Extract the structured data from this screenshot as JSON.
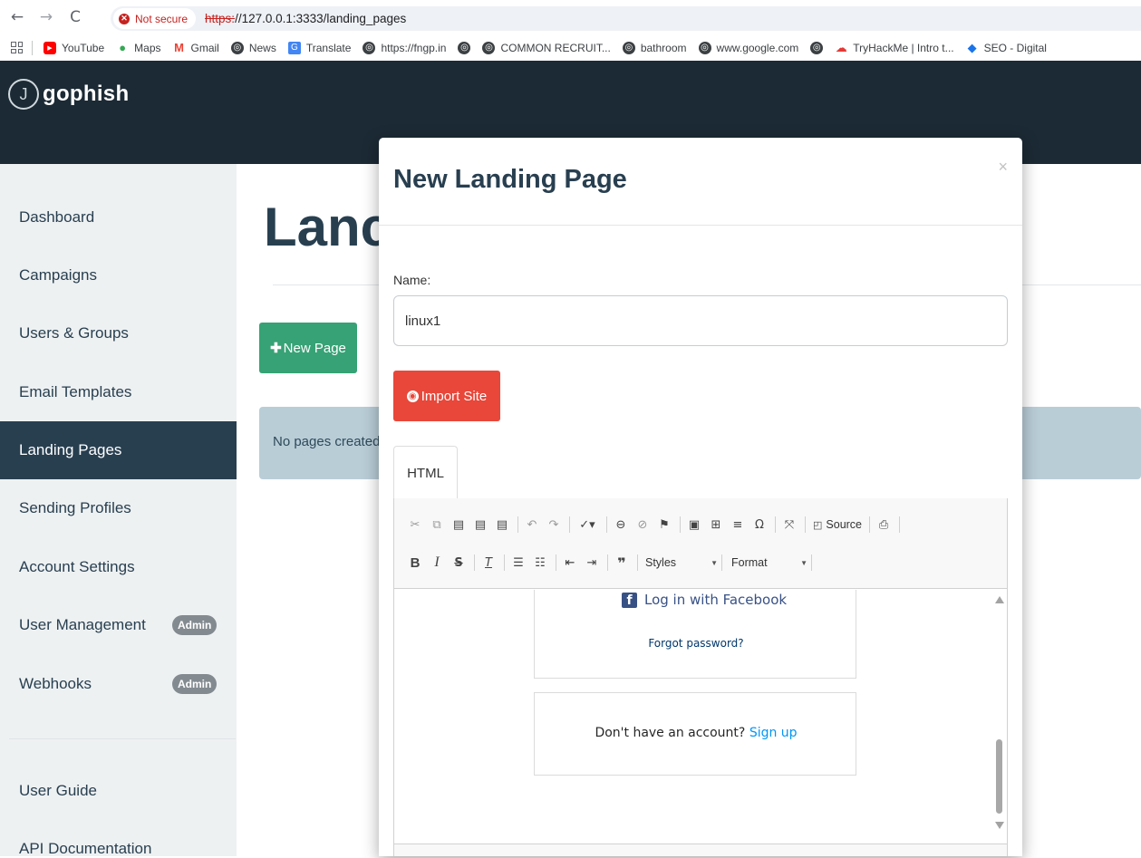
{
  "browser": {
    "security_label": "Not secure",
    "url_scheme": "https:",
    "url_rest": "//127.0.0.1:3333/landing_pages",
    "bookmarks": [
      "YouTube",
      "Maps",
      "Gmail",
      "News",
      "Translate",
      "https://fngp.in",
      "",
      "COMMON RECRUIT...",
      "bathroom",
      "www.google.com",
      "",
      "TryHackMe | Intro t...",
      "SEO - Digital"
    ]
  },
  "app": {
    "logo_text": "gophish"
  },
  "sidebar": {
    "items": [
      {
        "label": "Dashboard"
      },
      {
        "label": "Campaigns"
      },
      {
        "label": "Users & Groups"
      },
      {
        "label": "Email Templates"
      },
      {
        "label": "Landing Pages"
      },
      {
        "label": "Sending Profiles"
      },
      {
        "label": "Account Settings"
      },
      {
        "label": "User Management",
        "badge": "Admin"
      },
      {
        "label": "Webhooks",
        "badge": "Admin"
      },
      {
        "label": "User Guide"
      },
      {
        "label": "API Documentation"
      }
    ]
  },
  "main": {
    "title": "Landing Pages",
    "title_visible": "Lanc",
    "new_page_label": "New Page",
    "empty_text": "No pages created"
  },
  "modal": {
    "title": "New Landing Page",
    "close": "×",
    "name_label": "Name:",
    "name_value": "linux1",
    "import_label": "Import Site",
    "tab_html": "HTML",
    "toolbar": {
      "source_label": "Source",
      "styles_label": "Styles",
      "format_label": "Format"
    },
    "preview": {
      "fb_login": "Log in with Facebook",
      "forgot": "Forgot password?",
      "no_account": "Don't have an account?",
      "sign_up": "Sign up"
    }
  },
  "colors": {
    "topbar": "#1c2a35",
    "sidebar_active": "#283f50",
    "new_page_button": "#37a275",
    "import_button": "#e8473a",
    "alert_bg": "#b9cdd7"
  }
}
